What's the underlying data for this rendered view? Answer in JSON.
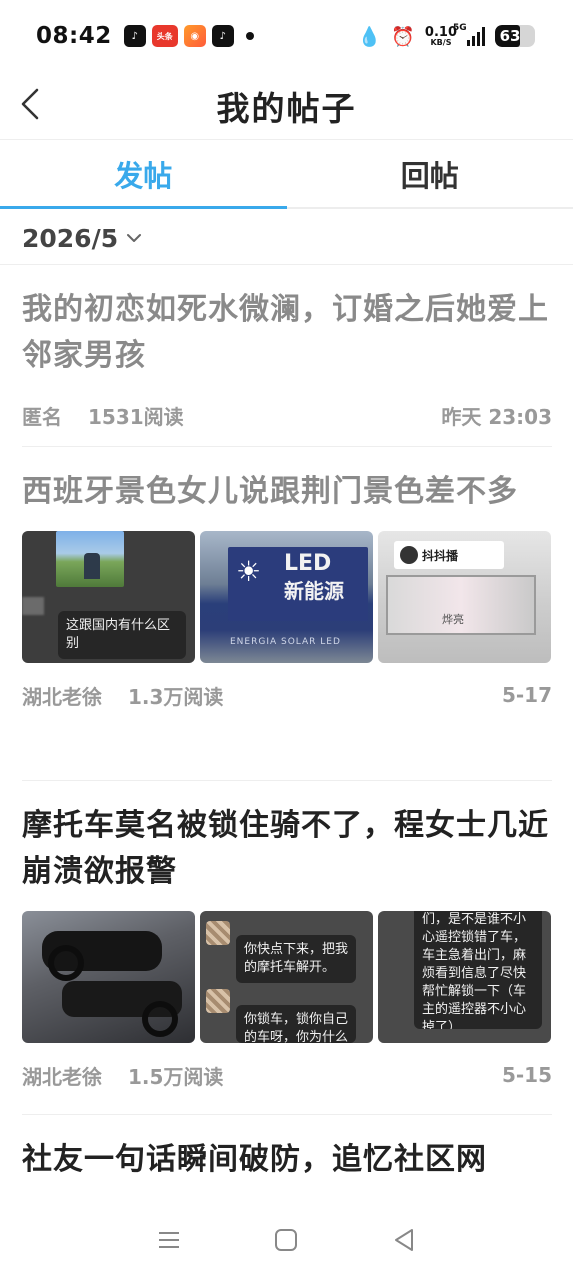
{
  "status_bar": {
    "time": "08:42",
    "apps": [
      "tiktok-icon",
      "toutiao-icon",
      "kuaishou-icon",
      "tiktok-icon"
    ],
    "toutiao_label": "头条",
    "net_speed_value": "0.10",
    "net_speed_unit": "KB/S",
    "network": "5G",
    "battery": "63",
    "battery_level": 0.63
  },
  "header": {
    "title": "我的帖子"
  },
  "tabs": [
    {
      "label": "发帖",
      "active": true
    },
    {
      "label": "回帖",
      "active": false
    }
  ],
  "filter": {
    "date": "2026/5"
  },
  "posts": [
    {
      "title": "我的初恋如死水微澜，订婚之后她爱上邻家男孩",
      "read": true,
      "author": "匿名",
      "views": "1531阅读",
      "date": "昨天 23:03"
    },
    {
      "title": "西班牙景色女儿说跟荆门景色差不多",
      "read": true,
      "images": {
        "img1_caption": "这跟国内有什么区别",
        "img2_sign_top": "LED",
        "img2_sign_bottom": "新能源",
        "img2_subtext": "ENERGIA SOLAR LED",
        "img3_sign": "抖抖播",
        "img3_label": "烨亮"
      },
      "author": "湖北老徐",
      "views": "1.3万阅读",
      "date": "5-17"
    },
    {
      "title": "摩托车莫名被锁住骑不了，程女士几近崩溃欲报警",
      "read": false,
      "images": {
        "img2_bubble1": "你快点下来，把我的摩托车解开。",
        "img2_bubble2": "你锁车，锁你自己的车呀，你为什么",
        "img3_text": "们，是不是谁不小心遥控锁错了车，车主急着出门，麻烦看到信息了尽快帮忙解锁一下（车主的遥控器不小心掉了）"
      },
      "author": "湖北老徐",
      "views": "1.5万阅读",
      "date": "5-15"
    },
    {
      "title": "社友一句话瞬间破防，追忆社区网",
      "read": false
    }
  ],
  "colors": {
    "accent": "#39a9eb",
    "read_title": "#8a8a8a",
    "meta": "#999999"
  }
}
